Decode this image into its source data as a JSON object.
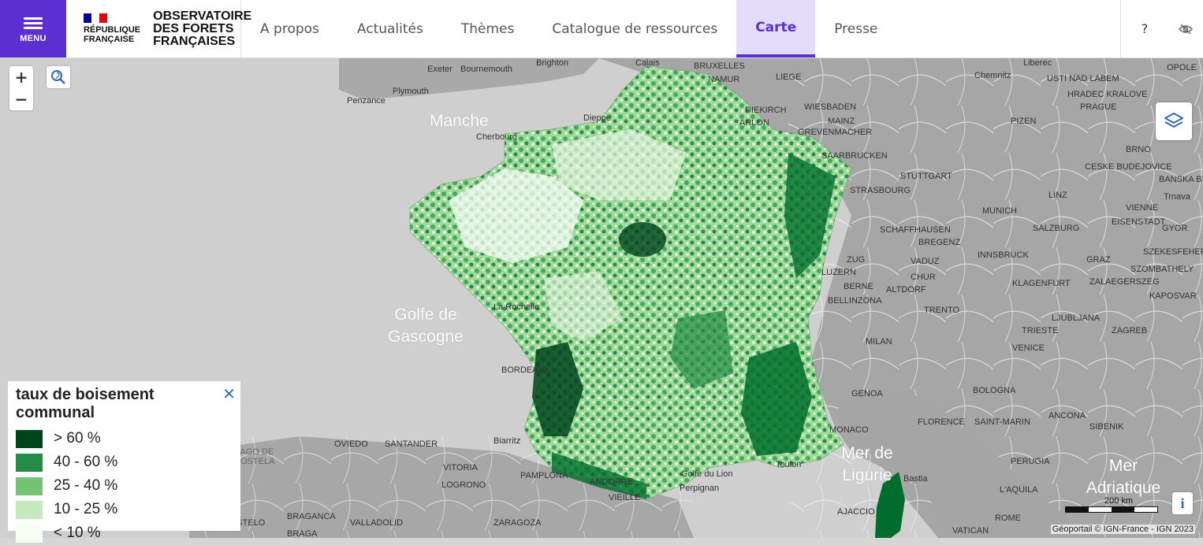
{
  "header": {
    "menu_label": "MENU",
    "republique_line1": "RÉPUBLIQUE",
    "republique_line2": "FRANÇAISE",
    "site_line1": "OBSERVATOIRE",
    "site_line2": "DES FORETS",
    "site_line3": "FRANÇAISES",
    "nav": [
      "A propos",
      "Actualités",
      "Thèmes",
      "Catalogue de ressources",
      "Carte",
      "Presse"
    ],
    "active_nav": "Carte",
    "help_label": "?",
    "colors": {
      "menu_bg": "#5b2fd2",
      "active_bg": "#e3dcfa"
    }
  },
  "map": {
    "sea_labels": [
      "Manche",
      "Golfe de Gascogne",
      "Mer de Ligurie",
      "Mer Adriatique"
    ],
    "city_labels": [
      "BRUXELLES",
      "NAMUR",
      "LIEGE",
      "DIEKIRCH",
      "ARLON",
      "WIESBADEN",
      "MAINZ",
      "GREVENMACHER",
      "SAARBRUCKEN",
      "STUTTGART",
      "STRASBOURG",
      "MUNICH",
      "SCHAFFHAUSEN",
      "BREGENZ",
      "VADUZ",
      "ZUG",
      "LUZERN",
      "CHUR",
      "BERNE",
      "ALTDORF",
      "BELLINZONA",
      "INNSBRUCK",
      "SALZBURG",
      "LINZ",
      "PRAGUE",
      "PIZEN",
      "USTI NAD LABEM",
      "HRADEC KRALOVE",
      "BRNO",
      "CESKE BUDEJOVICE",
      "VIENNE",
      "EISENSTADT",
      "GRAZ",
      "KLAGENFURT",
      "ZALAEGERSZEG",
      "SZOMBATHELY",
      "KAPOSVAR",
      "LJUBLJANA",
      "ZAGREB",
      "TRIESTE",
      "VENICE",
      "TRENTO",
      "MILAN",
      "GENOA",
      "BOLOGNA",
      "FLORENCE",
      "SAINT-MARIN",
      "ANCONA",
      "SIBENIK",
      "PERUGIA",
      "L'AQUILA",
      "ROME",
      "VATICAN",
      "AJACCIO",
      "MONACO",
      "BORDEAUX",
      "OVIEDO",
      "SANTANDER",
      "VITORIA",
      "LOGRONO",
      "PAMPLONA",
      "ANDORRE",
      "VIEILLE",
      "ZARAGOZA",
      "VALLADOLID",
      "BRAGANCA",
      "BRAGA",
      "VIANA DO CASTELO",
      "SANTIAGO DE COMPOSTELA",
      "Biarritz",
      "La Rochelle",
      "Penzance",
      "Plymouth",
      "Exeter",
      "Bournemouth",
      "Brighton",
      "Calais",
      "Cherbourg",
      "Dieppe",
      "Golfe du Lion",
      "Toulon",
      "Bastia",
      "Perpignan",
      "Liberec",
      "Chemnitz",
      "OPOLE",
      "BANSKA BYSTRICA",
      "GYOR",
      "SZEKESFEHERVAR",
      "Trnava"
    ],
    "scale_label": "200 km",
    "attribution": "Géoportail © IGN-France - IGN 2023"
  },
  "legend": {
    "title": "taux de boisement communal",
    "close": "✕",
    "items": [
      {
        "label": "> 60 %",
        "color": "#00441b"
      },
      {
        "label": "40 - 60 %",
        "color": "#238b45"
      },
      {
        "label": "25 - 40 %",
        "color": "#74c476"
      },
      {
        "label": "10 - 25 %",
        "color": "#c7e9c0"
      },
      {
        "label": "< 10 %",
        "color": "#f7fcf5"
      }
    ]
  },
  "controls": {
    "zoom_in": "+",
    "zoom_out": "−",
    "info": "i"
  }
}
